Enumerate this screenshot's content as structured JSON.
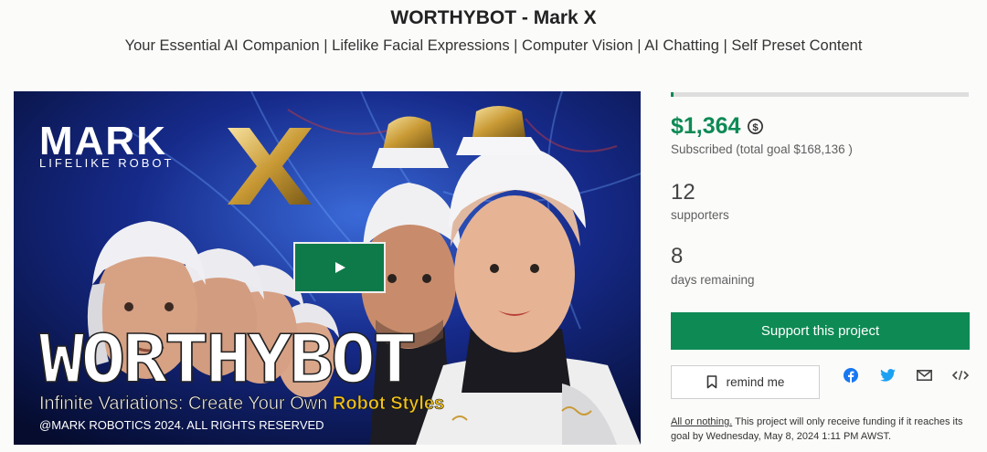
{
  "project": {
    "title": "WORTHYBOT - Mark X",
    "tagline": "Your Essential AI Companion | Lifelike Facial Expressions | Computer Vision | AI Chatting | Self Preset Content"
  },
  "video": {
    "brand_logo": "MARK",
    "brand_sub": "LIFELIKE ROBOT",
    "headline": "WORTHYBOT",
    "caption_lead": "Infinite Variations: Create Your Own ",
    "caption_highlight": "Robot Styles",
    "copyright": "@MARK ROBOTICS 2024. ALL RIGHTS RESERVED",
    "play_icon": "play-icon"
  },
  "funding": {
    "progress_fraction": 0.0081,
    "pledged": "$1,364",
    "pledged_label": "Subscribed (total goal $168,136 )",
    "supporters": "12",
    "supporters_label": "supporters",
    "days": "8",
    "days_label": "days remaining"
  },
  "actions": {
    "support_label": "Support this project",
    "remind_label": "remind me"
  },
  "share_icons": [
    "facebook-icon",
    "twitter-icon",
    "email-icon",
    "embed-icon"
  ],
  "footnote": {
    "link": "All or nothing.",
    "text": " This project will only receive funding if it reaches its goal by Wednesday, May 8, 2024 1:11 PM AWST."
  },
  "colors": {
    "accent": "#0e8a54",
    "progress_track": "#dedede",
    "video_bg": "#0a1440",
    "caption_highlight": "#f2c21b"
  }
}
